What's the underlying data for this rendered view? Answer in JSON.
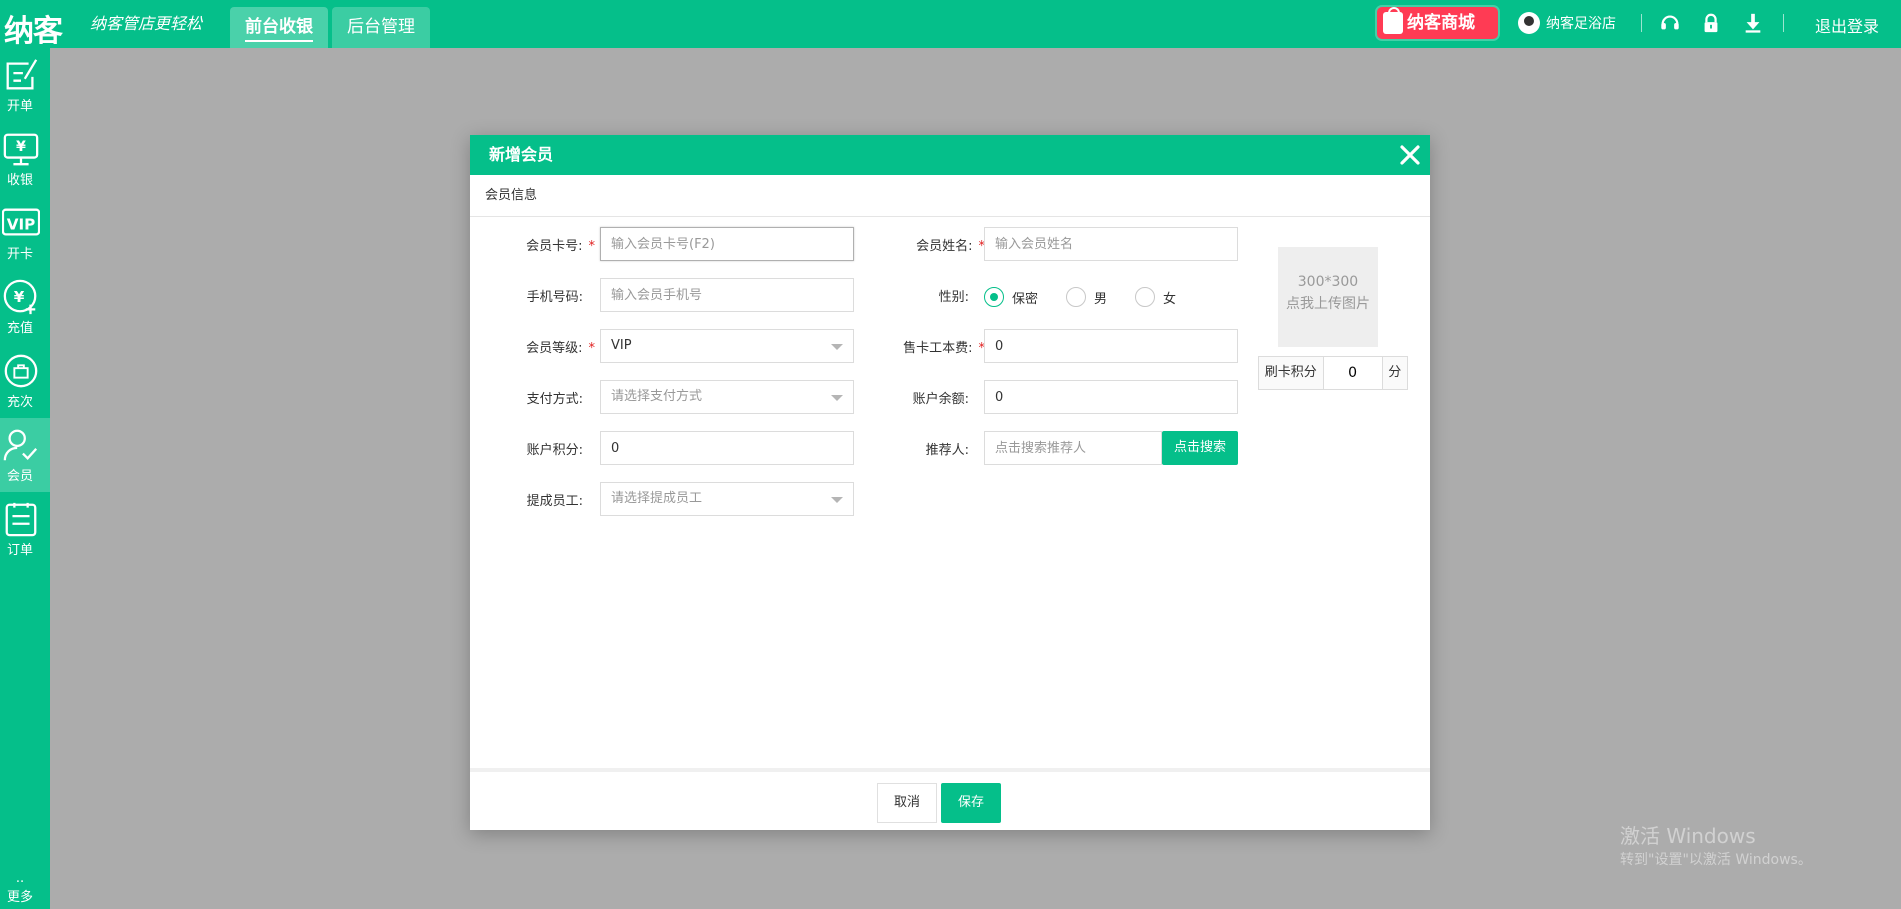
{
  "header": {
    "logo": "纳客",
    "slogan": "纳客管店更轻松",
    "tabs": [
      {
        "label": "前台收银",
        "active": true
      },
      {
        "label": "后台管理",
        "active": false
      }
    ],
    "mall": "纳客商城",
    "user": "纳客足浴店",
    "icons": [
      "headset-icon",
      "lock-icon",
      "download-icon"
    ],
    "logout": "退出登录"
  },
  "sidebar": {
    "items": [
      {
        "label": "开单",
        "icon": "edit-icon"
      },
      {
        "label": "收银",
        "icon": "cashier-icon"
      },
      {
        "label": "开卡",
        "icon": "vip-card-icon"
      },
      {
        "label": "充值",
        "icon": "recharge-icon"
      },
      {
        "label": "充次",
        "icon": "bag-icon"
      },
      {
        "label": "会员",
        "icon": "member-icon",
        "active": true
      },
      {
        "label": "订单",
        "icon": "order-icon"
      }
    ],
    "more": "更多"
  },
  "modal": {
    "title": "新增会员",
    "section": "会员信息",
    "fields": {
      "card_no": {
        "label": "会员卡号:",
        "placeholder": "输入会员卡号(F2)",
        "required": true
      },
      "name": {
        "label": "会员姓名:",
        "placeholder": "输入会员姓名",
        "required": true
      },
      "phone": {
        "label": "手机号码:",
        "placeholder": "输入会员手机号"
      },
      "gender": {
        "label": "性别:",
        "options": [
          "保密",
          "男",
          "女"
        ],
        "selected": "保密"
      },
      "level": {
        "label": "会员等级:",
        "value": "VIP",
        "required": true
      },
      "card_fee": {
        "label": "售卡工本费:",
        "value": "0",
        "required": true
      },
      "payment": {
        "label": "支付方式:",
        "placeholder": "请选择支付方式"
      },
      "balance": {
        "label": "账户余额:",
        "value": "0"
      },
      "points": {
        "label": "账户积分:",
        "value": "0"
      },
      "referrer": {
        "label": "推荐人:",
        "placeholder": "点击搜索推荐人",
        "button": "点击搜索"
      },
      "staff": {
        "label": "提成员工:",
        "placeholder": "请选择提成员工"
      }
    },
    "upload": {
      "size": "300*300",
      "hint": "点我上传图片"
    },
    "swipe_points": {
      "label": "刷卡积分",
      "value": "0",
      "unit": "分"
    },
    "cancel": "取消",
    "save": "保存"
  },
  "watermark": {
    "line1": "激活 Windows",
    "line2": "转到\"设置\"以激活 Windows。"
  },
  "colors": {
    "brand": "#05bf8a",
    "overlay": "#acacac",
    "required": "#e02020",
    "mall": "#ff3b54"
  }
}
